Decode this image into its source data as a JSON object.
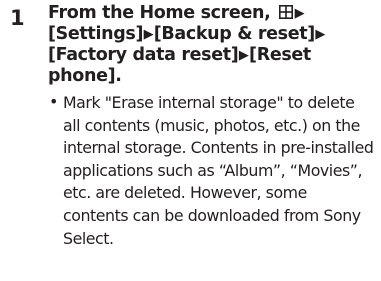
{
  "step": {
    "number": "1",
    "heading": {
      "part1": "From the Home screen,",
      "icon_name": "apps-grid-icon",
      "arrow": "▶",
      "item_settings": "[Settings]",
      "item_backup": "[Backup & reset]",
      "item_factory": "[Factory data reset]",
      "item_reset": "[Reset phone]."
    },
    "bullet": {
      "mark": "•",
      "text": "Mark \"Erase internal storage\" to delete all contents (music, photos, etc.) on the internal storage. Contents in pre-installed applications such as “Album”, “Movies”, etc. are deleted. However, some contents can be downloaded from Sony Select."
    }
  },
  "colors": {
    "text": "#231f20",
    "background": "#ffffff"
  }
}
